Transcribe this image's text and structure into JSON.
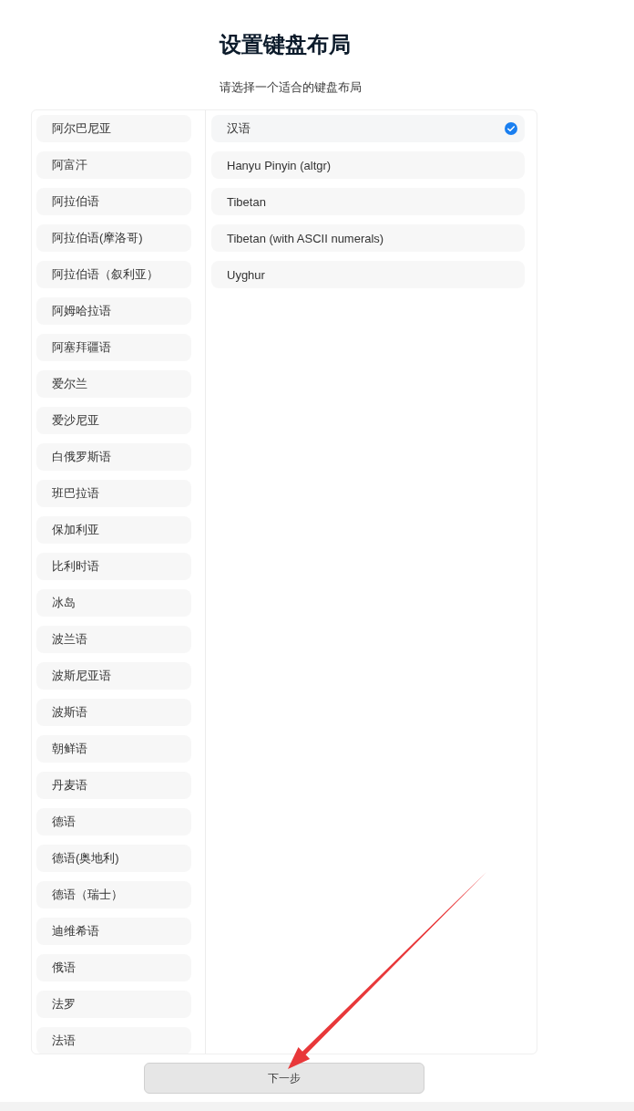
{
  "page": {
    "title": "设置键盘布局",
    "subtitle": "请选择一个适合的键盘布局"
  },
  "languages": [
    {
      "label": "阿尔巴尼亚",
      "selected": false
    },
    {
      "label": "阿富汗",
      "selected": false
    },
    {
      "label": "阿拉伯语",
      "selected": false
    },
    {
      "label": "阿拉伯语(摩洛哥)",
      "selected": false
    },
    {
      "label": "阿拉伯语（叙利亚）",
      "selected": false
    },
    {
      "label": "阿姆哈拉语",
      "selected": false
    },
    {
      "label": "阿塞拜疆语",
      "selected": false
    },
    {
      "label": "爱尔兰",
      "selected": false
    },
    {
      "label": "爱沙尼亚",
      "selected": false
    },
    {
      "label": "白俄罗斯语",
      "selected": false
    },
    {
      "label": "班巴拉语",
      "selected": false
    },
    {
      "label": "保加利亚",
      "selected": false
    },
    {
      "label": "比利时语",
      "selected": false
    },
    {
      "label": "冰岛",
      "selected": false
    },
    {
      "label": "波兰语",
      "selected": false
    },
    {
      "label": "波斯尼亚语",
      "selected": false
    },
    {
      "label": "波斯语",
      "selected": false
    },
    {
      "label": "朝鲜语",
      "selected": false
    },
    {
      "label": "丹麦语",
      "selected": false
    },
    {
      "label": "德语",
      "selected": false
    },
    {
      "label": "德语(奥地利)",
      "selected": false
    },
    {
      "label": "德语（瑞士）",
      "selected": false
    },
    {
      "label": "迪维希语",
      "selected": false
    },
    {
      "label": "俄语",
      "selected": false
    },
    {
      "label": "法罗",
      "selected": false
    },
    {
      "label": "法语",
      "selected": false
    }
  ],
  "layouts": [
    {
      "label": "汉语",
      "selected": true
    },
    {
      "label": "Hanyu Pinyin (altgr)",
      "selected": false
    },
    {
      "label": "Tibetan",
      "selected": false
    },
    {
      "label": "Tibetan (with ASCII numerals)",
      "selected": false
    },
    {
      "label": "Uyghur",
      "selected": false
    }
  ],
  "next_button": {
    "label": "下一步"
  }
}
